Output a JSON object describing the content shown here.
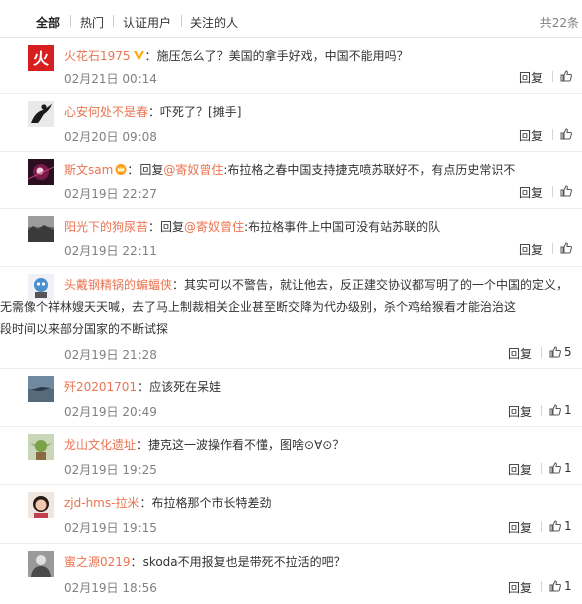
{
  "tabs": [
    "全部",
    "热门",
    "认证用户",
    "关注的人"
  ],
  "total_text": "共22条",
  "reply_label": "回复",
  "colors": {
    "nick": "#eb7350",
    "time": "#808080",
    "text": "#333333"
  },
  "comments": [
    {
      "nick": "火花石1975",
      "verified": true,
      "avatar_icon": "huo-avatar",
      "text": "施压怎么了？美国的拿手好戏，中国不能用吗？",
      "time": "02月21日 00:14",
      "likes": ""
    },
    {
      "nick": "心安何处不是春",
      "text": "吓死了？[摊手]",
      "time": "02月20日 09:08",
      "likes": ""
    },
    {
      "nick": "斯文sam",
      "crown_badge": true,
      "prefix": "回复",
      "mention": "@寄奴曾住",
      "text": ":布拉格之春中国支持捷克喷苏联好不，有点历史常识不",
      "time": "02月19日 22:27",
      "likes": ""
    },
    {
      "nick": "阳光下的狗尿苔",
      "prefix": "回复",
      "mention": "@寄奴曾住",
      "text": ":布拉格事件上中国可没有站苏联的队",
      "time": "02月19日 22:11",
      "likes": ""
    },
    {
      "nick": "头戴钢精锅的蝙蝠侠",
      "text": "其实可以不警告，就让他去，反正建交协议都写明了的一个中国的定义，",
      "text2": "无需像个祥林嫂天天喊，去了马上制裁相关企业甚至断交降为代办级别，杀个鸡给猴看才能治治这",
      "text3": "段时间以来部分国家的不断试探",
      "time": "02月19日 21:28",
      "likes": "5"
    },
    {
      "nick": "歼20201701",
      "text": "应该死在呆娃",
      "time": "02月19日 20:49",
      "likes": "1"
    },
    {
      "nick": "龙山文化遗址",
      "text": "捷克这一波操作看不懂，图啥⊙∀⊙？",
      "time": "02月19日 19:25",
      "likes": "1"
    },
    {
      "nick": "zjd-hms-拉米",
      "text": "布拉格那个市长特差劲",
      "time": "02月19日 19:15",
      "likes": "1"
    },
    {
      "nick": "蜜之源0219",
      "text": "skoda不用报复也是带死不拉活的吧？",
      "time": "02月19日 18:56",
      "likes": "1"
    }
  ]
}
